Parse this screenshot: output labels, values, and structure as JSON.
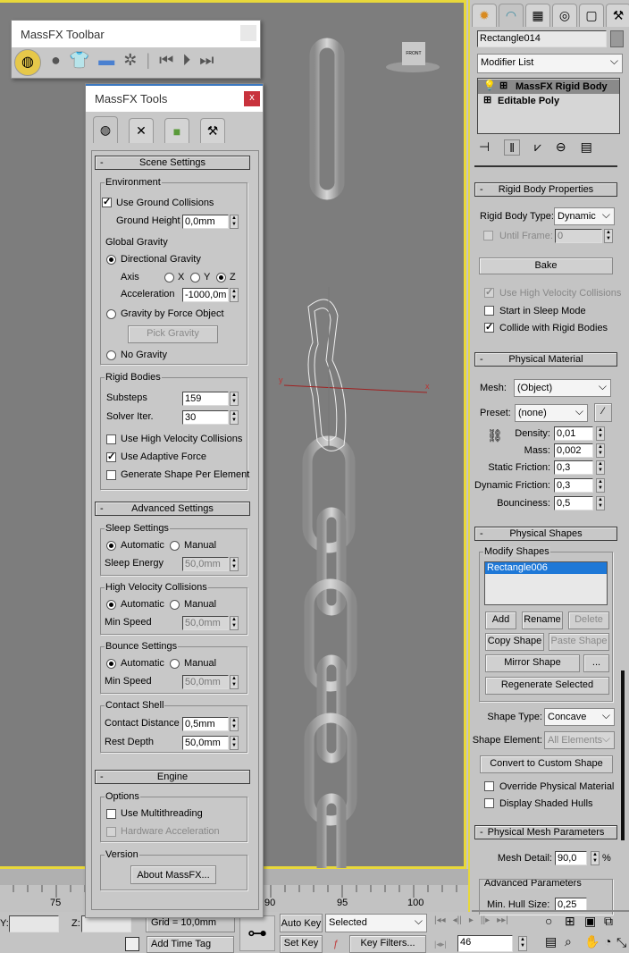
{
  "toolbar": {
    "title": "MassFX Toolbar"
  },
  "tools": {
    "title": "MassFX Tools",
    "close": "x",
    "scene": {
      "header": "Scene Settings",
      "env": "Environment",
      "use_ground": "Use Ground Collisions",
      "ground_height_label": "Ground Height",
      "ground_height": "0,0mm",
      "global_gravity": "Global Gravity",
      "directional": "Directional Gravity",
      "axis": "Axis",
      "x": "X",
      "y": "Y",
      "z": "Z",
      "accel_label": "Acceleration",
      "accel": "-1000,0m",
      "force_object": "Gravity by Force Object",
      "pick_gravity": "Pick Gravity",
      "no_gravity": "No Gravity",
      "rigid": "Rigid Bodies",
      "substeps_label": "Substeps",
      "substeps": "159",
      "solver_label": "Solver Iter.",
      "solver": "30",
      "hvc": "Use High Velocity Collisions",
      "adaptive": "Use Adaptive Force",
      "gen_shape": "Generate Shape Per Element"
    },
    "advanced": {
      "header": "Advanced Settings",
      "sleep": "Sleep Settings",
      "automatic": "Automatic",
      "manual": "Manual",
      "sleep_energy_label": "Sleep Energy",
      "sleep_energy": "50,0mm",
      "hvc": "High Velocity Collisions",
      "min_speed_label": "Min Speed",
      "hvc_speed": "50,0mm",
      "bounce": "Bounce Settings",
      "bounce_speed": "50,0mm",
      "contact": "Contact Shell",
      "contact_dist_label": "Contact Distance",
      "contact_dist": "0,5mm",
      "rest_depth_label": "Rest Depth",
      "rest_depth": "50,0mm"
    },
    "engine": {
      "header": "Engine",
      "options": "Options",
      "multithread": "Use Multithreading",
      "hw_accel": "Hardware Acceleration",
      "version": "Version",
      "about": "About MassFX..."
    }
  },
  "panel": {
    "object_name": "Rectangle014",
    "modifier_list": "Modifier List",
    "stack": [
      "MassFX Rigid Body",
      "Editable Poly"
    ],
    "rbp": {
      "header": "Rigid Body Properties",
      "type_label": "Rigid Body Type:",
      "type": "Dynamic",
      "until_label": "Until Frame:",
      "until": "0",
      "bake": "Bake",
      "hvc": "Use High Velocity Collisions",
      "sleep": "Start in Sleep Mode",
      "collide": "Collide with Rigid Bodies"
    },
    "pm": {
      "header": "Physical Material",
      "mesh_label": "Mesh:",
      "mesh": "(Object)",
      "preset_label": "Preset:",
      "preset": "(none)",
      "density_label": "Density:",
      "density": "0,01",
      "mass_label": "Mass:",
      "mass": "0,002",
      "sf_label": "Static Friction:",
      "sf": "0,3",
      "df_label": "Dynamic Friction:",
      "df": "0,3",
      "b_label": "Bounciness:",
      "b": "0,5"
    },
    "ps": {
      "header": "Physical Shapes",
      "modify": "Modify Shapes",
      "shape": "Rectangle006",
      "add": "Add",
      "rename": "Rename",
      "delete": "Delete",
      "copy": "Copy Shape",
      "paste": "Paste Shape",
      "mirror": "Mirror Shape",
      "more": "...",
      "regen": "Regenerate Selected",
      "type_label": "Shape Type:",
      "type": "Concave",
      "elem_label": "Shape Element:",
      "elem": "All Elements",
      "convert": "Convert to Custom Shape",
      "override": "Override Physical Material",
      "hulls": "Display Shaded Hulls"
    },
    "pmp": {
      "header": "Physical Mesh Parameters",
      "detail_label": "Mesh Detail:",
      "detail": "90,0",
      "pct": "%",
      "adv": "Advanced Parameters",
      "hull_label": "Min. Hull Size:",
      "hull": "0,25"
    }
  },
  "timeline": {
    "ticks": [
      "75",
      "90",
      "95",
      "100"
    ]
  },
  "status": {
    "y_label": "Y:",
    "z_label": "Z:",
    "grid": "Grid = 10,0mm",
    "add_time_tag": "Add Time Tag",
    "auto_key": "Auto Key",
    "set_key": "Set Key",
    "selected": "Selected",
    "key_filters": "Key Filters...",
    "frame": "46"
  },
  "viewcube": "FRONT",
  "colors": {
    "viewport_border": "#e8d83a",
    "selection": "#1e78d7",
    "close": "#c8323c"
  }
}
